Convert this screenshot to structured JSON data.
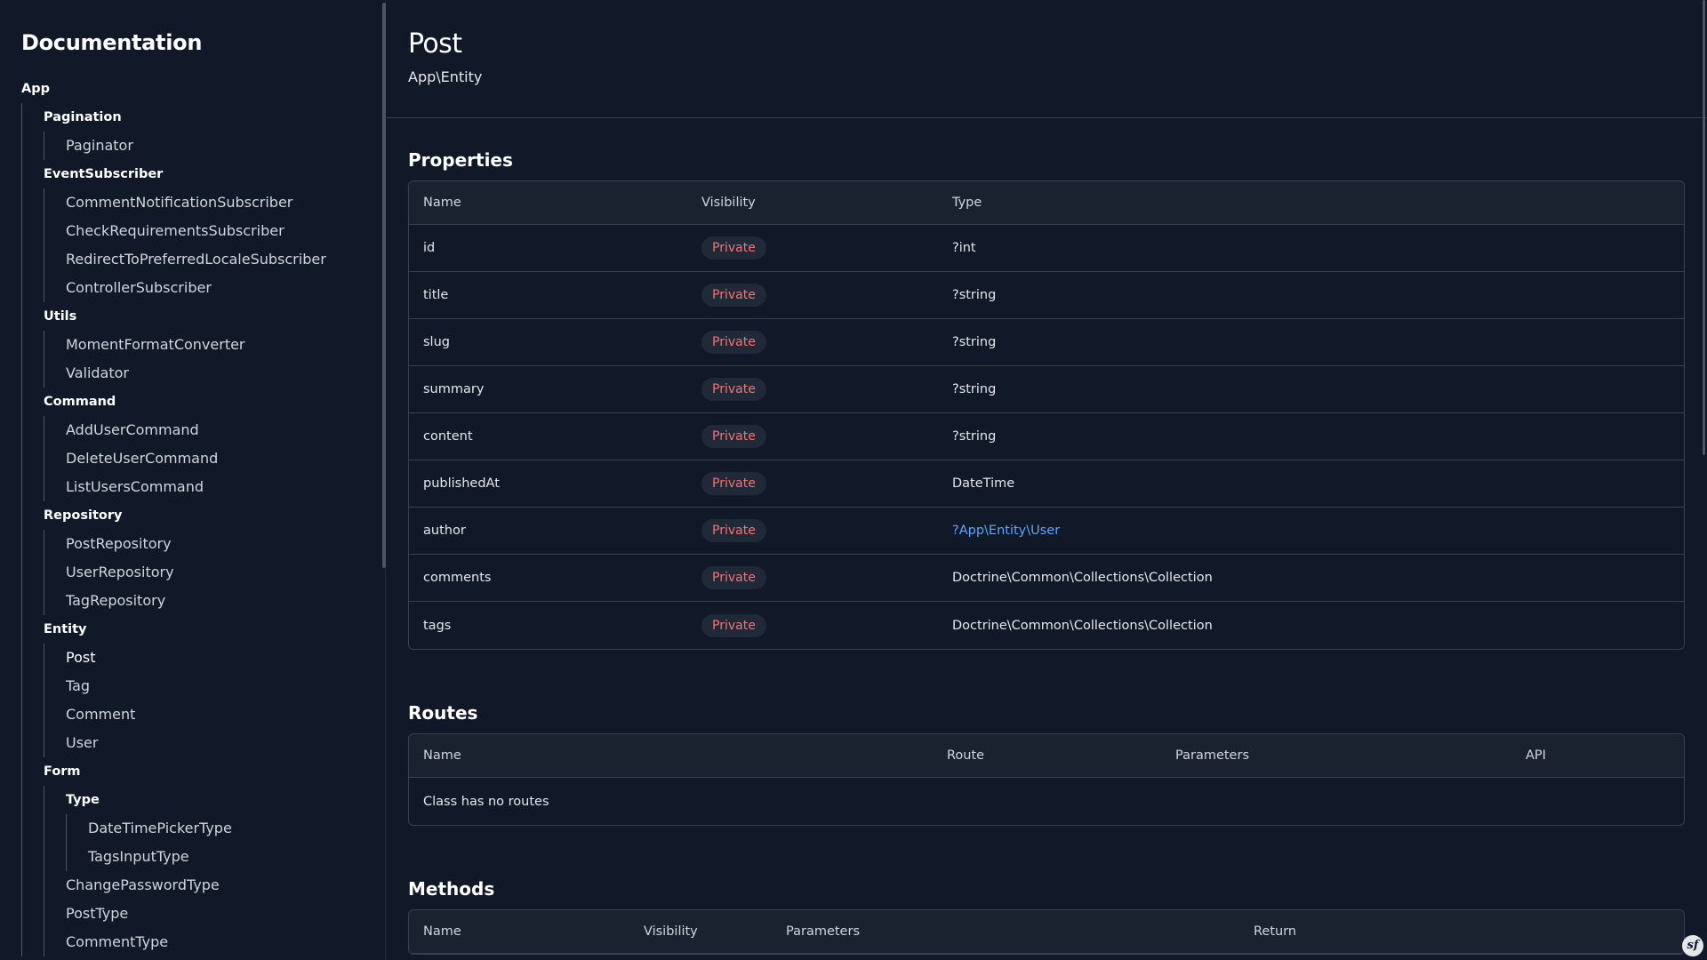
{
  "sidebar": {
    "title": "Documentation",
    "root": "App",
    "groups": {
      "pagination": {
        "label": "Pagination",
        "items": [
          "Paginator"
        ]
      },
      "eventsubscriber": {
        "label": "EventSubscriber",
        "items": [
          "CommentNotificationSubscriber",
          "CheckRequirementsSubscriber",
          "RedirectToPreferredLocaleSubscriber",
          "ControllerSubscriber"
        ]
      },
      "utils": {
        "label": "Utils",
        "items": [
          "MomentFormatConverter",
          "Validator"
        ]
      },
      "command": {
        "label": "Command",
        "items": [
          "AddUserCommand",
          "DeleteUserCommand",
          "ListUsersCommand"
        ]
      },
      "repository": {
        "label": "Repository",
        "items": [
          "PostRepository",
          "UserRepository",
          "TagRepository"
        ]
      },
      "entity": {
        "label": "Entity",
        "items": [
          "Post",
          "Tag",
          "Comment",
          "User"
        ]
      },
      "form": {
        "label": "Form",
        "type": {
          "label": "Type",
          "items": [
            "DateTimePickerType",
            "TagsInputType"
          ]
        },
        "items": [
          "ChangePasswordType",
          "PostType",
          "CommentType"
        ]
      }
    }
  },
  "header": {
    "title": "Post",
    "namespace": "App\\Entity"
  },
  "properties": {
    "heading": "Properties",
    "columns": [
      "Name",
      "Visibility",
      "Type"
    ],
    "rows": [
      {
        "name": "id",
        "visibility": "Private",
        "type": "?int"
      },
      {
        "name": "title",
        "visibility": "Private",
        "type": "?string"
      },
      {
        "name": "slug",
        "visibility": "Private",
        "type": "?string"
      },
      {
        "name": "summary",
        "visibility": "Private",
        "type": "?string"
      },
      {
        "name": "content",
        "visibility": "Private",
        "type": "?string"
      },
      {
        "name": "publishedAt",
        "visibility": "Private",
        "type": "DateTime"
      },
      {
        "name": "author",
        "visibility": "Private",
        "type": "?App\\Entity\\User"
      },
      {
        "name": "comments",
        "visibility": "Private",
        "type": "Doctrine\\Common\\Collections\\Collection"
      },
      {
        "name": "tags",
        "visibility": "Private",
        "type": "Doctrine\\Common\\Collections\\Collection"
      }
    ]
  },
  "routes": {
    "heading": "Routes",
    "columns": [
      "Name",
      "Route",
      "Parameters",
      "API"
    ],
    "empty": "Class has no routes"
  },
  "methods": {
    "heading": "Methods",
    "columns": [
      "Name",
      "Visibility",
      "Parameters",
      "Return"
    ]
  },
  "colors": {
    "background": "#111827",
    "badge_text": "#f87171",
    "link": "#60a5fa"
  },
  "icons": {
    "corner": "symfony-icon"
  }
}
